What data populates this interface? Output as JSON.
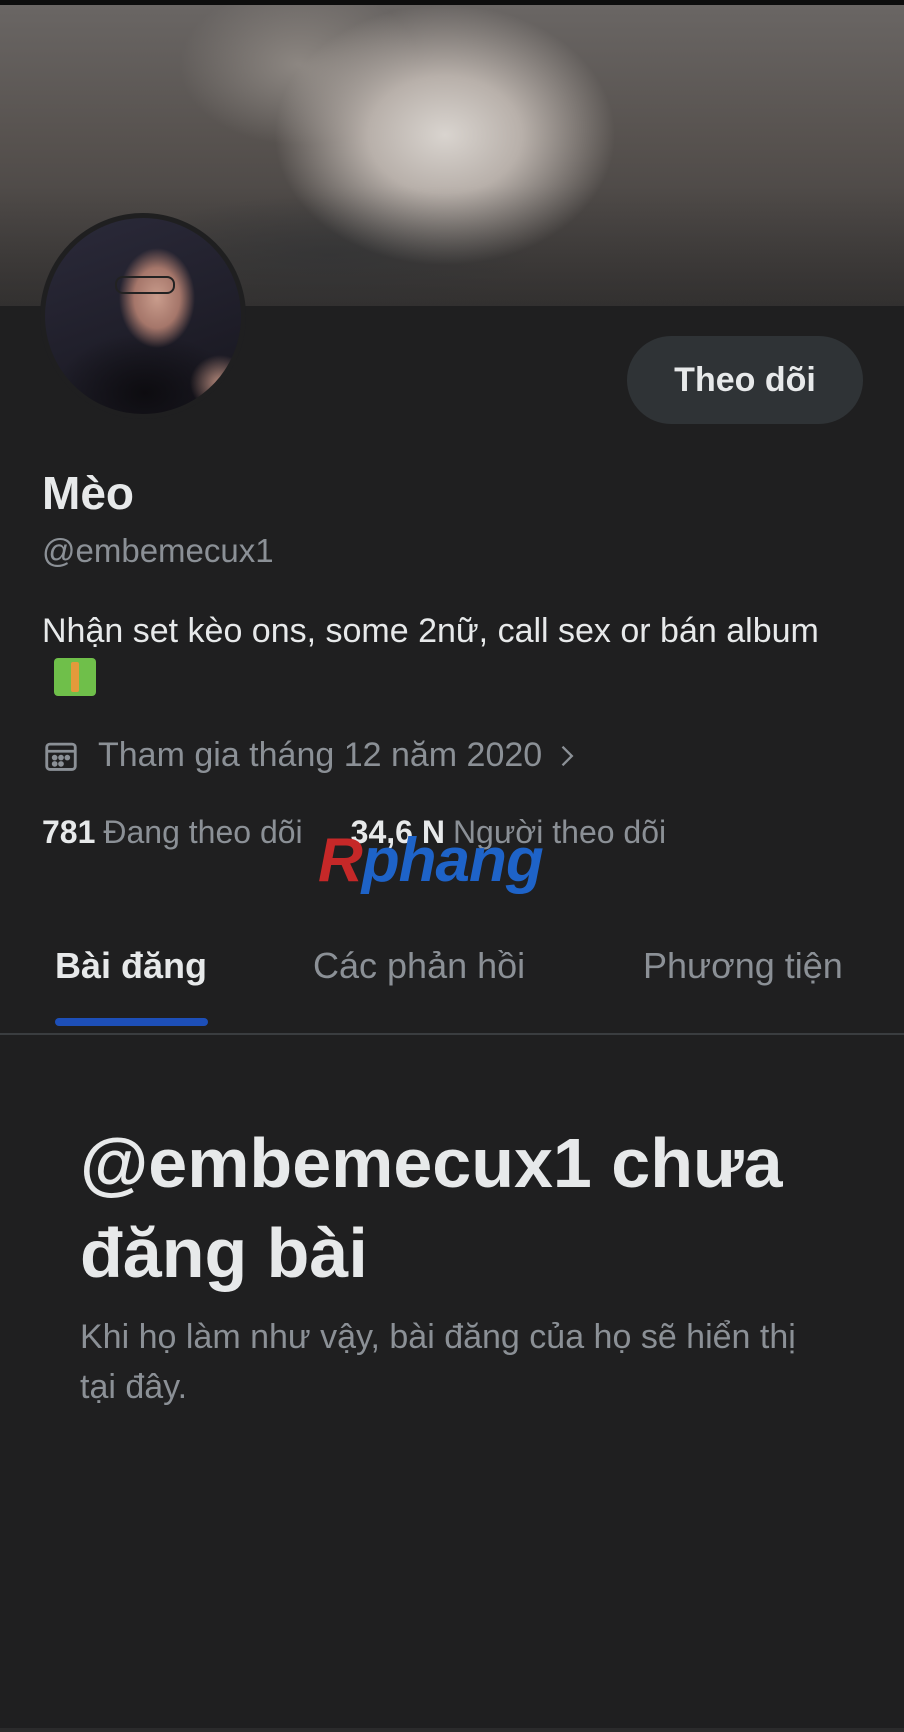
{
  "profile": {
    "display_name": "Mèo",
    "handle": "@embemecux1",
    "bio": "Nhận set kèo ons, some 2nữ, call sex or bán album",
    "bio_emoji": "money-with-dollar-icon",
    "joined": "Tham gia tháng 12 năm 2020",
    "follow_label": "Theo dõi"
  },
  "stats": {
    "following_count": "781",
    "following_label": "Đang theo dõi",
    "followers_count": "34,6 N",
    "followers_label": "Người theo dõi"
  },
  "watermark": {
    "part1": "R",
    "part2": "phang"
  },
  "tabs": [
    {
      "label": "Bài đăng",
      "active": true
    },
    {
      "label": "Các phản hồi",
      "active": false
    },
    {
      "label": "Phương tiện",
      "active": false
    }
  ],
  "empty_state": {
    "title": "@embemecux1 chưa đăng bài",
    "description": "Khi họ làm như vậy, bài đăng của họ sẽ hiển thị tại đây."
  },
  "colors": {
    "background": "#1f1f20",
    "text_primary": "#e7e9ea",
    "text_secondary": "#8b9096",
    "tab_indicator": "#1d4fb8",
    "button_bg": "#2f3336"
  }
}
